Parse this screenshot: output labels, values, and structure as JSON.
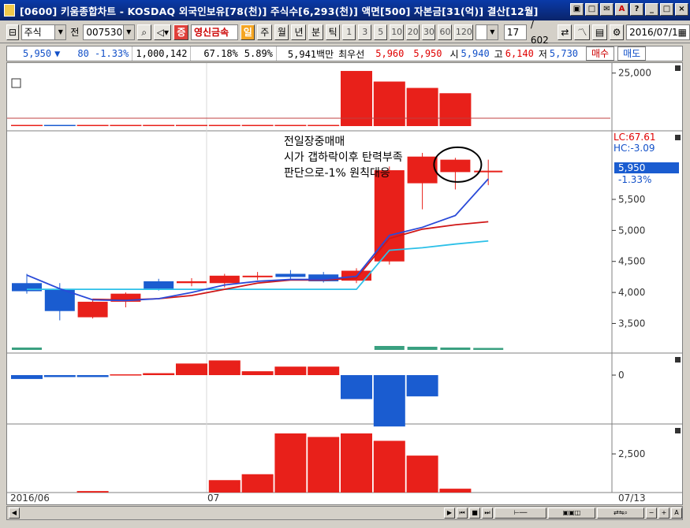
{
  "window": {
    "title": "[0600] 키움종합차트 - KOSDAQ 외국인보유[78(천)] 주식수[6,293(천)] 액면[500] 자본금[31(억)] 결산[12월]",
    "buttons": [
      "▣",
      "□",
      "✉",
      "A",
      "?",
      "_",
      "□",
      "×"
    ]
  },
  "toolbar": {
    "market": "주식",
    "prev_label": "전",
    "code": "007530",
    "badge": "증",
    "stock_name": "영신금속",
    "periods": [
      "일",
      "주",
      "월",
      "년",
      "분",
      "틱"
    ],
    "intervals": [
      "1",
      "3",
      "5",
      "10",
      "20",
      "30",
      "60",
      "120"
    ],
    "count": "17",
    "total": "/ 602",
    "date": "2016/07/1"
  },
  "info": {
    "price": "5,950",
    "arrow": "▼",
    "change": "80 -1.33%",
    "volume": "1,000,142",
    "ratio": "67.18%",
    "turnover": "5.89%",
    "amount": "5,941백만",
    "best_label": "최우선",
    "ask": "5,960",
    "bid": "5,950",
    "open_label": "시",
    "open": "5,940",
    "high_label": "고",
    "high": "6,140",
    "low_label": "저",
    "low": "5,730",
    "buy_label": "매수",
    "sell_label": "매도"
  },
  "annotation": {
    "lines": [
      "전일장중매매",
      "시가 갭하락이후 탄력부족",
      "판단으로-1% 원칙대응"
    ]
  },
  "side_labels": {
    "lc": "LC:67.61",
    "hc": "HC:-3.09",
    "current": "5,950",
    "current_pct": "-1.33%"
  },
  "colors": {
    "up": "#e8201a",
    "down": "#1a5cd0",
    "ma_red": "#d01818",
    "ma_blue": "#2a4ad8",
    "ma_cyan": "#2cc0e8",
    "volume_osc": "#3aa080"
  },
  "chart_data": [
    {
      "type": "bar",
      "name": "foreign_volume_panel",
      "x": [
        "d1",
        "d2",
        "d3",
        "d4",
        "d5",
        "d6",
        "d7",
        "d8",
        "d9",
        "d10",
        "d11",
        "d12",
        "d13",
        "d14",
        "d15"
      ],
      "values": [
        120,
        140,
        80,
        60,
        70,
        90,
        80,
        90,
        100,
        110,
        26000,
        21000,
        18000,
        15500,
        0
      ],
      "yticks": [
        "25,000"
      ],
      "ylim": [
        0,
        27500
      ]
    },
    {
      "type": "candlestick",
      "name": "price_panel",
      "candles": [
        {
          "o": 4150,
          "c": 4020,
          "h": 4300,
          "l": 3980,
          "up": false
        },
        {
          "o": 4050,
          "c": 3700,
          "h": 4150,
          "l": 3550,
          "up": false
        },
        {
          "o": 3600,
          "c": 3850,
          "h": 3900,
          "l": 3580,
          "up": true
        },
        {
          "o": 3850,
          "c": 3980,
          "h": 4000,
          "l": 3760,
          "up": true
        },
        {
          "o": 4180,
          "c": 4060,
          "h": 4220,
          "l": 4030,
          "up": false
        },
        {
          "o": 4150,
          "c": 4180,
          "h": 4230,
          "l": 4100,
          "up": true
        },
        {
          "o": 4150,
          "c": 4270,
          "h": 4300,
          "l": 4080,
          "up": true
        },
        {
          "o": 4260,
          "c": 4270,
          "h": 4330,
          "l": 4200,
          "up": true
        },
        {
          "o": 4300,
          "c": 4250,
          "h": 4360,
          "l": 4200,
          "up": false
        },
        {
          "o": 4290,
          "c": 4180,
          "h": 4330,
          "l": 4160,
          "up": false
        },
        {
          "o": 4190,
          "c": 4350,
          "h": 4390,
          "l": 4150,
          "up": true
        },
        {
          "o": 4500,
          "c": 5970,
          "h": 6030,
          "l": 4450,
          "up": true
        },
        {
          "o": 5760,
          "c": 6190,
          "h": 6250,
          "l": 5340,
          "up": true
        },
        {
          "o": 5940,
          "c": 6140,
          "h": 6170,
          "l": 5660,
          "up": true
        },
        {
          "o": 5950,
          "c": 5950,
          "h": 6140,
          "l": 5730,
          "up": true
        }
      ],
      "ma_red": [
        null,
        null,
        3890,
        3880,
        3900,
        3950,
        4050,
        4150,
        4200,
        4200,
        4230,
        4870,
        5020,
        5090,
        5140
      ],
      "ma_blue": [
        4280,
        4060,
        3880,
        3870,
        3900,
        4000,
        4120,
        4180,
        4210,
        4210,
        4260,
        4920,
        5050,
        5240,
        5830
      ],
      "ma_cyan": [
        4050,
        4050,
        4050,
        4050,
        4050,
        4050,
        4050,
        4050,
        4050,
        4050,
        4050,
        4680,
        4720,
        4780,
        4830
      ],
      "yticks": [
        "5,500",
        "5,000",
        "4,500",
        "4,000",
        "3,500"
      ],
      "ylim": [
        3150,
        6580
      ]
    },
    {
      "type": "bar",
      "name": "oscillator_panel",
      "values": [
        -1,
        -0.5,
        -0.5,
        0.2,
        0.5,
        3,
        3.8,
        1,
        2.2,
        2.2,
        -6.2,
        -13.3,
        -5.5
      ],
      "yticks": [
        "0"
      ],
      "ylim": [
        -15,
        6
      ]
    },
    {
      "type": "bar",
      "name": "volume_panel",
      "values": [
        0,
        0,
        50,
        0,
        0,
        0,
        420,
        620,
        2000,
        1880,
        2000,
        1750,
        1250,
        130
      ],
      "yticks": [
        "2,500"
      ],
      "ylim": [
        0,
        2000
      ]
    }
  ],
  "x_axis": {
    "labels": [
      "2016/06",
      "07",
      "07/13"
    ]
  }
}
